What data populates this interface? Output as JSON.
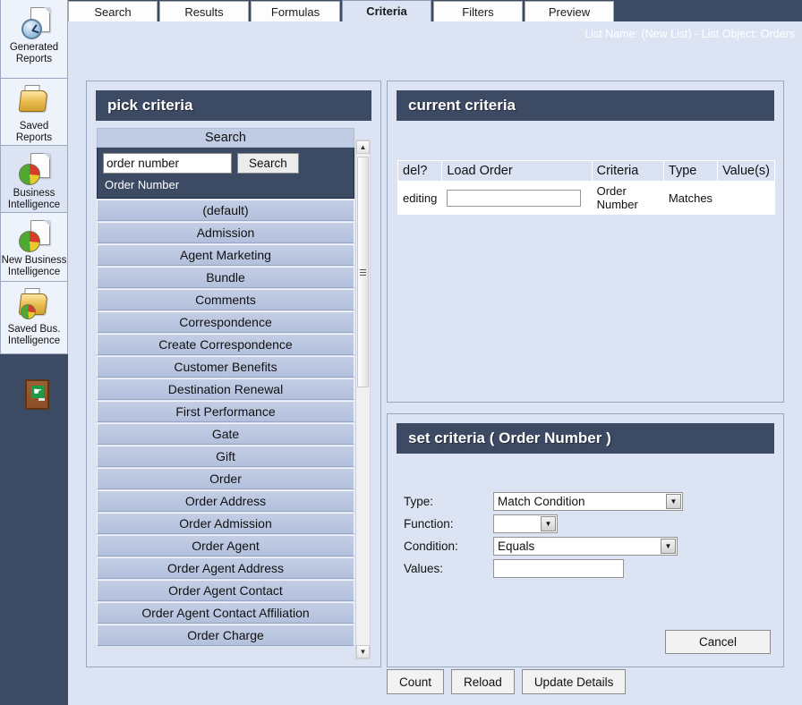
{
  "colors": {
    "chrome_dark": "#3d4a63",
    "content_bg": "#dce4f4",
    "panel_header_bg": "#3d4a63",
    "list_item_bg": "#bcc8e1"
  },
  "tabs": [
    {
      "label": "Search",
      "active": false
    },
    {
      "label": "Results",
      "active": false
    },
    {
      "label": "Formulas",
      "active": false
    },
    {
      "label": "Criteria",
      "active": true
    },
    {
      "label": "Filters",
      "active": false
    },
    {
      "label": "Preview",
      "active": false
    }
  ],
  "header": {
    "list_name_text": "List Name: (New List) - List Object: Orders"
  },
  "sidebar": {
    "items": [
      {
        "label": "Generated Reports",
        "icon": "clock-document-icon",
        "selected": false
      },
      {
        "label": "Saved Reports",
        "icon": "folder-document-icon",
        "selected": false
      },
      {
        "label": "Business Intelligence",
        "icon": "pie-document-icon",
        "selected": true
      },
      {
        "label": "New Business Intelligence",
        "icon": "pie-document-icon",
        "selected": false
      },
      {
        "label": "Saved Bus. Intelligence",
        "icon": "folder-pie-icon",
        "selected": false
      }
    ],
    "exit": {
      "icon": "exit-door-icon",
      "label": ""
    }
  },
  "pick_criteria": {
    "title": "pick criteria",
    "search_header": "Search",
    "search_value": "order number",
    "search_placeholder": "",
    "search_button": "Search",
    "search_result": "Order Number",
    "items": [
      "(default)",
      "Admission",
      "Agent Marketing",
      "Bundle",
      "Comments",
      "Correspondence",
      "Create Correspondence",
      "Customer Benefits",
      "Destination Renewal",
      "First Performance",
      "Gate",
      "Gift",
      "Order",
      "Order Address",
      "Order Admission",
      "Order Agent",
      "Order Agent Address",
      "Order Agent Contact",
      "Order Agent Contact Affiliation",
      "Order Charge"
    ],
    "scroll_up_glyph": "▲",
    "scroll_down_glyph": "▼"
  },
  "current_criteria": {
    "title": "current criteria",
    "columns": [
      "del?",
      "Load Order",
      "Criteria",
      "Type",
      "Value(s)"
    ],
    "rows": [
      {
        "del": "editing",
        "load_order_value": "",
        "criteria": "Order Number",
        "type": "Matches",
        "values": ""
      }
    ]
  },
  "set_criteria": {
    "title": "set criteria ( Order Number )",
    "fields": {
      "type_label": "Type:",
      "type_value": "Match Condition",
      "function_label": "Function:",
      "function_value": "",
      "condition_label": "Condition:",
      "condition_value": "Equals",
      "values_label": "Values:",
      "values_value": ""
    },
    "cancel_label": "Cancel",
    "dropdown_glyph": "▼"
  },
  "bottom_buttons": [
    {
      "label": "Count"
    },
    {
      "label": "Reload"
    },
    {
      "label": "Update Details"
    }
  ]
}
